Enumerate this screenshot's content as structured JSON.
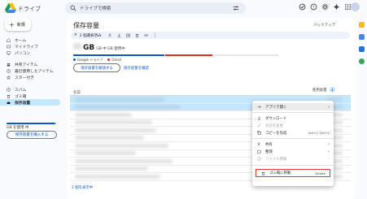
{
  "app": {
    "title": "ドライブ"
  },
  "search": {
    "placeholder": "ドライブで検索"
  },
  "sidebar": {
    "new_label": "新規",
    "items": [
      {
        "label": "ホーム",
        "icon": "home-icon"
      },
      {
        "label": "マイドライブ",
        "icon": "drive-icon"
      },
      {
        "label": "パソコン",
        "icon": "computer-icon"
      },
      {
        "label": "共有アイテム",
        "icon": "people-icon"
      },
      {
        "label": "最近使用したアイテム",
        "icon": "clock-icon"
      },
      {
        "label": "スター付き",
        "icon": "star-icon"
      },
      {
        "label": "スパム",
        "icon": "spam-icon"
      },
      {
        "label": "ゴミ箱",
        "icon": "trash-icon"
      },
      {
        "label": "保存容量",
        "icon": "cloud-icon"
      }
    ],
    "storage_text": "GB を使用 中",
    "buy_label": "保存容量を購入する"
  },
  "main": {
    "title": "保存容量",
    "backup_label": "バックアップ",
    "selection_count": "2 個選択済み",
    "usage_unit": "GB",
    "usage_suffix": "GB 中 GB 使用中",
    "legend": [
      "Google ドライブ",
      "Gmail"
    ],
    "free_button": "保存容量を解放する",
    "review_link": "保存容量を確認",
    "column_header": "名前",
    "sort_label": "使用容量",
    "footer_link": "2 個を表示中"
  },
  "context_menu": {
    "items": [
      {
        "label": "アプリで開く",
        "icon": "open-with-icon",
        "submenu": true,
        "disabled": false
      },
      {
        "label": "ダウンロード",
        "icon": "download-icon",
        "disabled": false
      },
      {
        "label": "名前を変更",
        "icon": "edit-icon",
        "disabled": true
      },
      {
        "label": "コピーを作成",
        "icon": "copy-icon",
        "shortcut": "Ctrl+C Ctrl+V",
        "disabled": false
      },
      {
        "label": "共有",
        "icon": "share-icon",
        "submenu": true,
        "disabled": false
      },
      {
        "label": "整理",
        "icon": "folder-icon",
        "submenu": true,
        "disabled": false
      },
      {
        "label": "ファイル情報",
        "icon": "info-icon",
        "submenu": true,
        "disabled": true
      },
      {
        "label": "ゴミ箱に移動",
        "icon": "trash-icon",
        "shortcut": "Delete",
        "disabled": false
      }
    ]
  },
  "colors": {
    "accent": "#0b57d0",
    "selected_row": "#c2e7ff",
    "gmail": "#d93025",
    "highlight_border": "#e53935"
  }
}
